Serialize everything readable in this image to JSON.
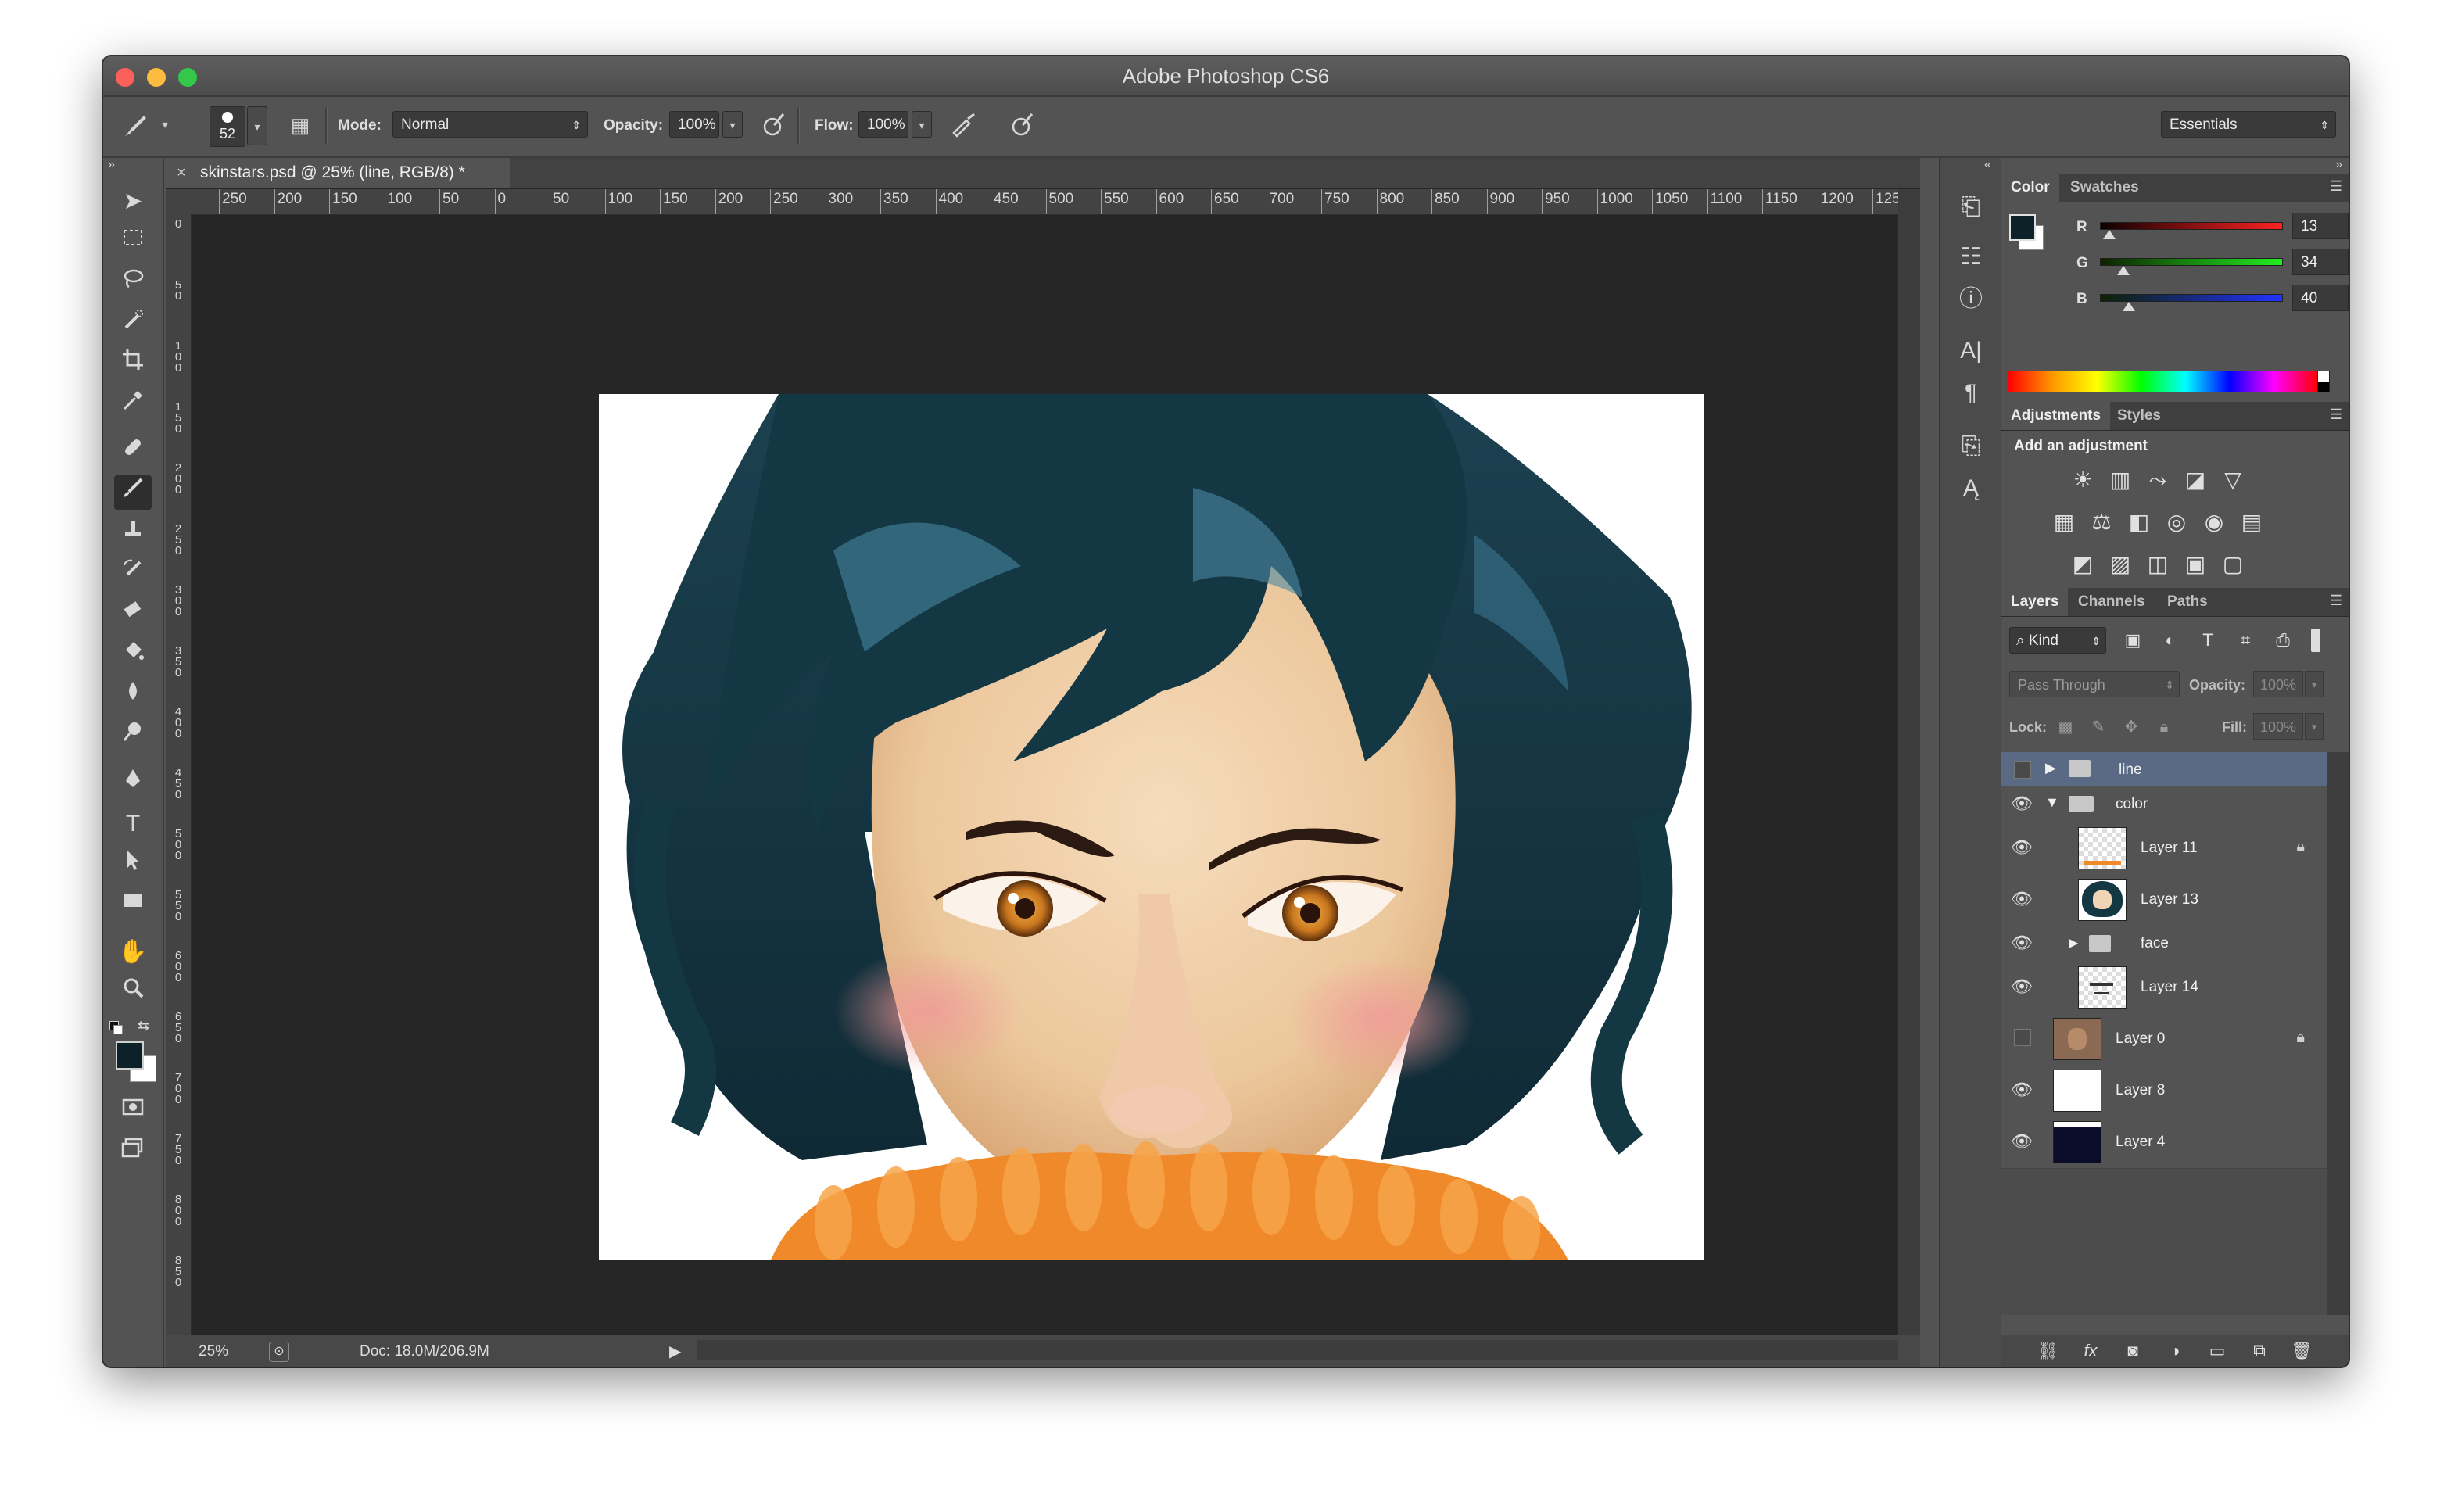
{
  "window": {
    "title": "Adobe Photoshop CS6"
  },
  "options": {
    "brush_size": "52",
    "mode_label": "Mode:",
    "mode_value": "Normal",
    "opacity_label": "Opacity:",
    "opacity_value": "100%",
    "flow_label": "Flow:",
    "flow_value": "100%",
    "workspace": "Essentials"
  },
  "document": {
    "tab_title": "skinstars.psd @ 25% (line, RGB/8) *",
    "zoom": "25%",
    "doc_info": "Doc: 18.0M/206.9M",
    "ruler_h": [
      "250",
      "200",
      "150",
      "100",
      "50",
      "0",
      "50",
      "100",
      "150",
      "200",
      "250",
      "300",
      "350",
      "400",
      "450",
      "500",
      "550",
      "600",
      "650",
      "700",
      "750",
      "800",
      "850",
      "900",
      "950",
      "1000",
      "1050",
      "1100",
      "1150",
      "1200",
      "125"
    ],
    "ruler_v": [
      "0",
      "50",
      "100",
      "150",
      "200",
      "250",
      "300",
      "350",
      "400",
      "450",
      "500",
      "550",
      "600",
      "650",
      "700",
      "750",
      "800",
      "850"
    ]
  },
  "color_panel": {
    "tabs": [
      "Color",
      "Swatches"
    ],
    "r_label": "R",
    "g_label": "G",
    "b_label": "B",
    "r": "13",
    "g": "34",
    "b": "40",
    "r_level": 0.05,
    "g_level": 0.13,
    "b_level": 0.16,
    "foreground": "#0d2228"
  },
  "adjustments_panel": {
    "tabs": [
      "Adjustments",
      "Styles"
    ],
    "heading": "Add an adjustment",
    "icons": [
      "brightness-contrast-icon",
      "levels-icon",
      "curves-icon",
      "exposure-icon",
      "vibrance-icon",
      "hue-saturation-icon",
      "color-balance-icon",
      "black-white-icon",
      "photo-filter-icon",
      "channel-mixer-icon",
      "color-lookup-icon",
      "invert-icon",
      "posterize-icon",
      "threshold-icon",
      "gradient-map-icon",
      "selective-color-icon"
    ]
  },
  "layers_panel": {
    "tabs": [
      "Layers",
      "Channels",
      "Paths"
    ],
    "filter_kind": "Kind",
    "blend_mode": "Pass Through",
    "opacity_label": "Opacity:",
    "opacity_value": "100%",
    "lock_label": "Lock:",
    "fill_label": "Fill:",
    "fill_value": "100%",
    "layers": [
      {
        "name": "line",
        "type": "group",
        "expanded": false,
        "visible": false,
        "selected": true
      },
      {
        "name": "color",
        "type": "group",
        "expanded": true,
        "visible": true
      },
      {
        "name": "Layer 11",
        "visible": true,
        "locked": true
      },
      {
        "name": "Layer 13",
        "visible": true
      },
      {
        "name": "face",
        "type": "group",
        "expanded": false,
        "visible": true
      },
      {
        "name": "Layer 14",
        "visible": true
      },
      {
        "name": "Layer 0",
        "visible": false,
        "locked": true
      },
      {
        "name": "Layer 8",
        "visible": true
      },
      {
        "name": "Layer 4",
        "visible": true
      }
    ]
  }
}
